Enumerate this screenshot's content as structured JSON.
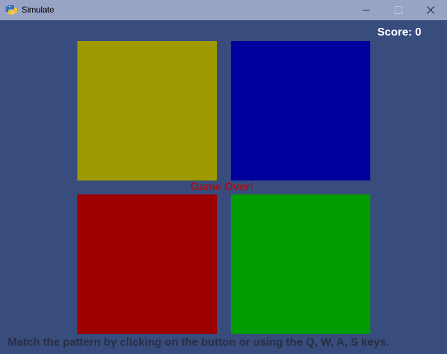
{
  "window": {
    "title": "Simulate",
    "icon": "python-snake-icon",
    "controls": [
      "minimize-icon",
      "maximize-icon",
      "close-icon"
    ]
  },
  "game": {
    "score_text": "Score: 0",
    "status_text": "Game Over!",
    "instructions": "Match the pattern by clicking on the button or using the Q, W, A, S keys.",
    "background_color": "#384d7e",
    "pads": [
      {
        "name": "yellow",
        "color": "#9c9a00"
      },
      {
        "name": "blue",
        "color": "#00009c"
      },
      {
        "name": "red",
        "color": "#9c0000"
      },
      {
        "name": "green",
        "color": "#009c00"
      }
    ]
  }
}
